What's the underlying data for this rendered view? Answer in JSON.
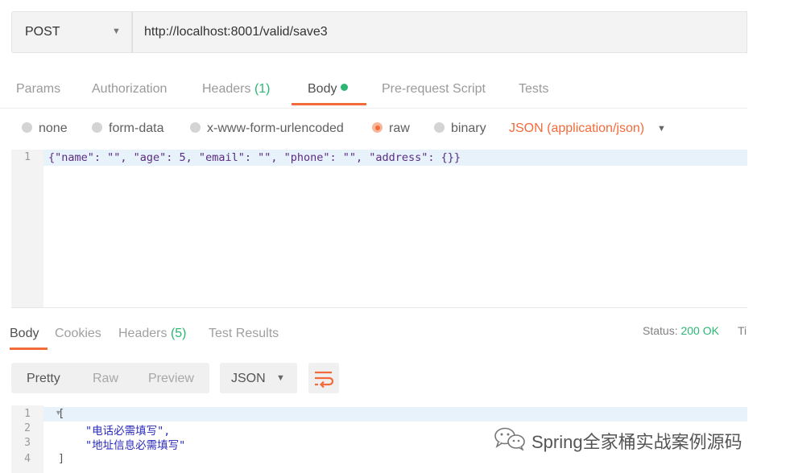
{
  "request": {
    "method": "POST",
    "url": "http://localhost:8001/valid/save3"
  },
  "request_tabs": [
    {
      "label": "Params"
    },
    {
      "label": "Authorization"
    },
    {
      "label": "Headers",
      "count": "(1)"
    },
    {
      "label": "Body"
    },
    {
      "label": "Pre-request Script"
    },
    {
      "label": "Tests"
    }
  ],
  "body_types": {
    "options": [
      "none",
      "form-data",
      "x-www-form-urlencoded",
      "raw",
      "binary"
    ],
    "selected": "raw",
    "content_type": "JSON (application/json)"
  },
  "request_body": {
    "line_numbers": [
      "1"
    ],
    "code": "{\"name\": \"\", \"age\": 5, \"email\": \"\", \"phone\": \"\", \"address\": {}}"
  },
  "response_tabs": [
    {
      "label": "Body"
    },
    {
      "label": "Cookies"
    },
    {
      "label": "Headers",
      "count": "(5)"
    },
    {
      "label": "Test Results"
    }
  ],
  "status": {
    "label": "Status:",
    "value": "200 OK",
    "extra": "Ti"
  },
  "view_modes": [
    "Pretty",
    "Raw",
    "Preview"
  ],
  "format": "JSON",
  "response_body": {
    "line_numbers": [
      "1",
      "2",
      "3",
      "4"
    ],
    "lines": [
      "[",
      "\"电话必需填写\",",
      "\"地址信息必需填写\"",
      "]"
    ]
  },
  "watermark": {
    "text": "Spring全家桶实战案例源码",
    "icon": "wechat-icon"
  },
  "colors": {
    "accent": "#f26b3a",
    "success": "#2bb673",
    "string": "#2a2ab8",
    "code": "#5a2d82"
  }
}
